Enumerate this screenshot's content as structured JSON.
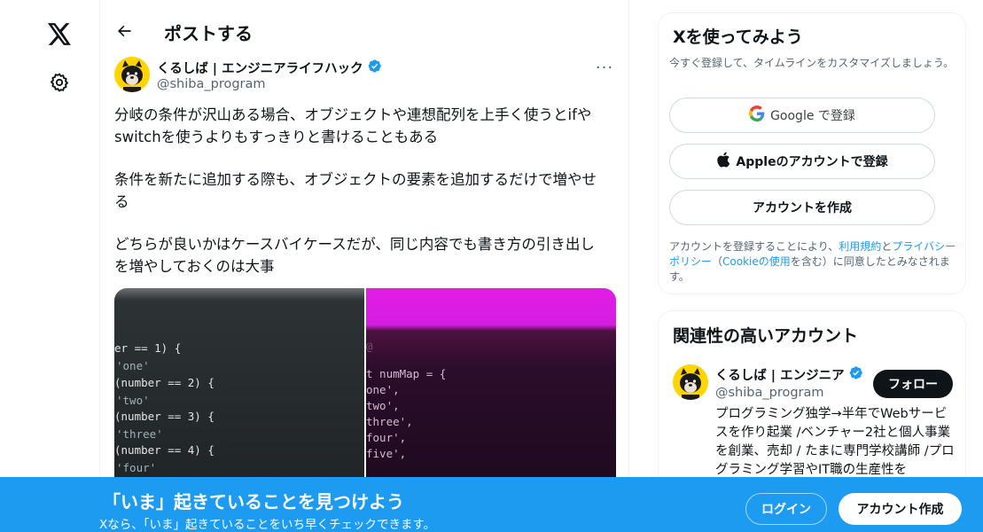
{
  "nav": {
    "logo_icon": "x-logo-icon",
    "settings_icon": "gear-icon"
  },
  "header": {
    "back_icon": "arrow-left-icon",
    "title": "ポストする"
  },
  "post": {
    "author_name": "くるしば | エンジニアライフハック",
    "author_handle": "@shiba_program",
    "verified": true,
    "more_label": "···",
    "paragraphs": [
      "分岐の条件が沢山ある場合、オブジェクトや連想配列を上手く使うとifや\nswitchを使うよりもすっきりと書けることもある",
      "条件を新たに追加する際も、オブジェクトの要素を追加するだけで増やせ\nる",
      "どちらが良いかはケースバイケースだが、同じ内容でも書き方の引き出し\nを増やしておくのは大事"
    ],
    "media": {
      "left_code": [
        "er == 1) {",
        "'one'",
        "(number == 2) {",
        "'two'",
        "(number == 3) {",
        "'three'",
        "(number == 4) {",
        "'four'"
      ],
      "right_code": [
        "@",
        "t numMap = {",
        "one',",
        "two',",
        "three',",
        "four',",
        "five',"
      ]
    }
  },
  "signup_box": {
    "title": "Xを使ってみよう",
    "subtitle": "今すぐ登録して、タイムラインをカスタマイズしましょう。",
    "google_label": "Google で登録",
    "apple_label": "Appleのアカウントで登録",
    "create_label": "アカウントを作成",
    "legal_prefix": "アカウントを登録することにより、",
    "legal_terms": "利用規約",
    "legal_and": "と",
    "legal_privacy": "プライバシーポリシー",
    "legal_paren_open": "（",
    "legal_cookie": "Cookieの使用",
    "legal_suffix": "を含む）に同意したとみなされます。"
  },
  "related_box": {
    "title": "関連性の高いアカウント",
    "account_name": "くるしば | エンジニア",
    "account_handle": "@shiba_program",
    "follow_label": "フォロー",
    "bio": "プログラミング独学→半年でWebサービスを作り起業 /ベンチャー2社と個人事業を創業、売却 / たまに専門学校講師 /プログラミング学習やIT職の生産性を"
  },
  "banner": {
    "title": "「いま」起きていることを見つけよう",
    "subtitle": "Xなら、「いま」起きていることをいち早くチェックできます。",
    "login_label": "ログイン",
    "signup_label": "アカウント作成"
  },
  "colors": {
    "accent": "#1d9bf0",
    "text": "#0f1419",
    "muted": "#536471",
    "avatar_bg": "#ffd400"
  }
}
